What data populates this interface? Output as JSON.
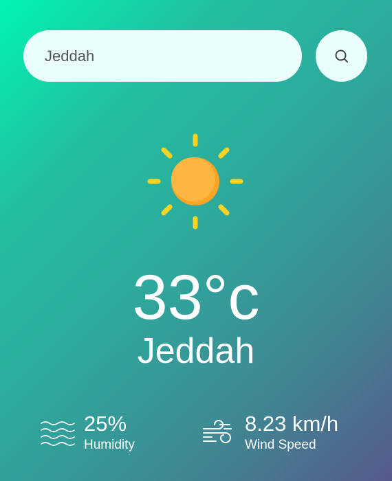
{
  "search": {
    "value": "Jeddah",
    "button_icon": "search-icon"
  },
  "weather": {
    "icon": "sun-icon",
    "temperature": "33°c",
    "city": "Jeddah"
  },
  "details": {
    "humidity": {
      "icon": "humidity-waves-icon",
      "value": "25%",
      "label": "Humidity"
    },
    "wind": {
      "icon": "wind-icon",
      "value": "8.23 km/h",
      "label": "Wind Speed"
    }
  },
  "colors": {
    "gradient_start": "#00f5b0",
    "gradient_end": "#575a8c",
    "sun_body": "#ffb23f",
    "sun_rays": "#ffd21f",
    "input_bg": "#eafffc"
  }
}
